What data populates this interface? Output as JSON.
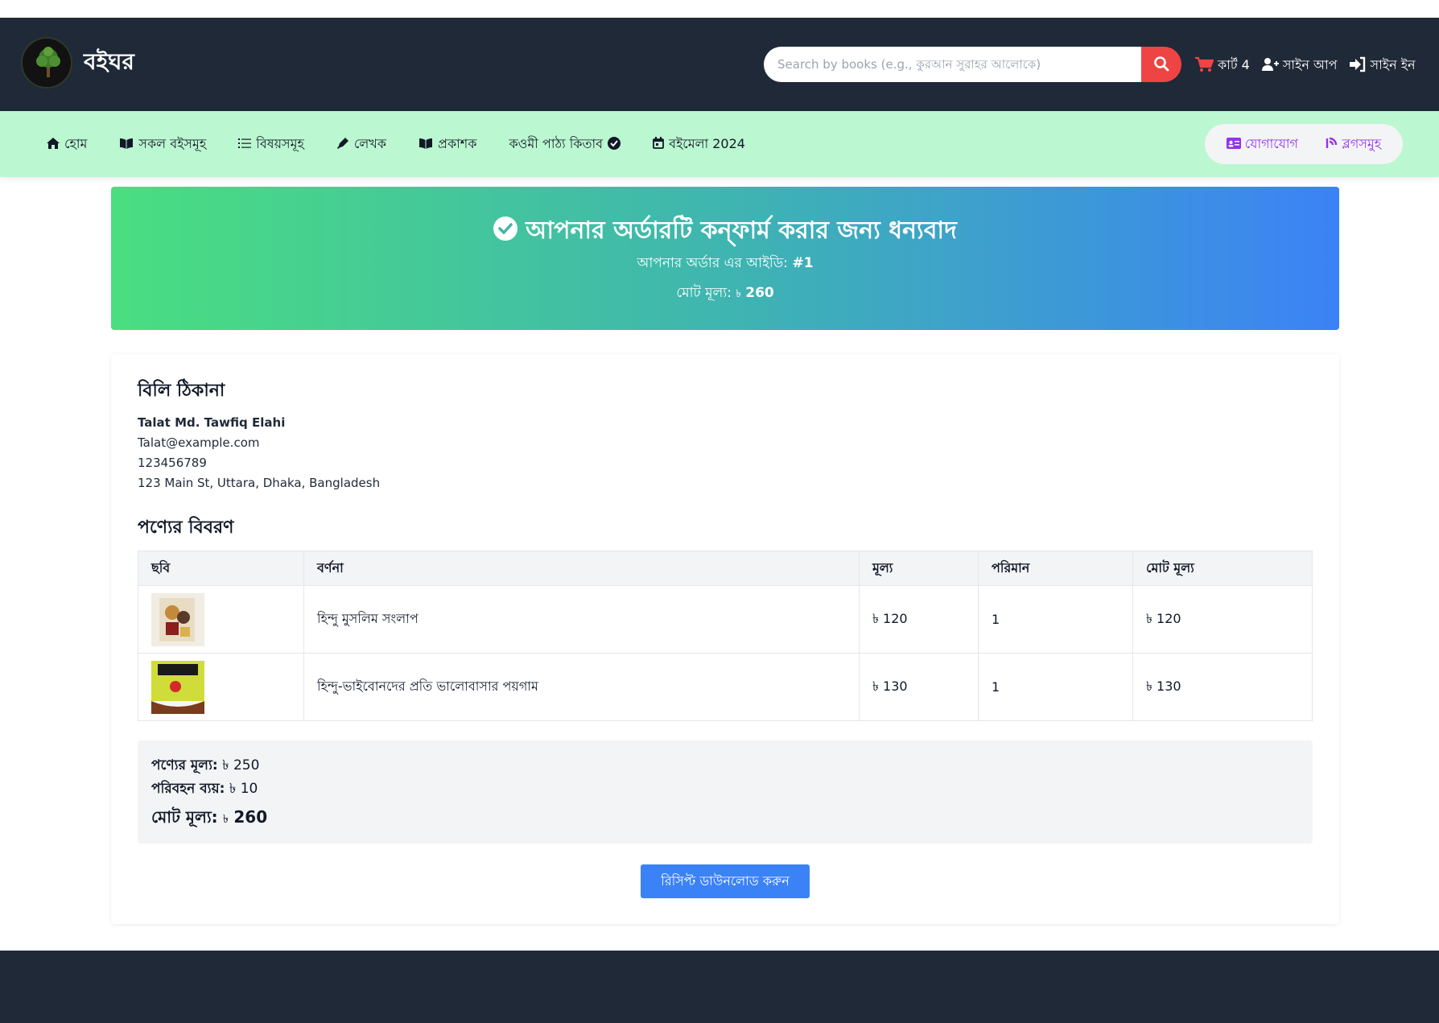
{
  "header": {
    "brand": "বইঘর",
    "search_placeholder": "Search by books (e.g., কুরআন সুরাহর আলোকে)",
    "cart_label": "কার্ট 4",
    "signup_label": "সাইন আপ",
    "signin_label": "সাইন ইন"
  },
  "nav": {
    "items": [
      {
        "label": "হোম",
        "icon": "home-icon"
      },
      {
        "label": "সকল বইসমূহ",
        "icon": "book-open-icon"
      },
      {
        "label": "বিষয়সমূহ",
        "icon": "list-icon"
      },
      {
        "label": "লেখক",
        "icon": "pen-icon"
      },
      {
        "label": "প্রকাশক",
        "icon": "book-open-icon"
      },
      {
        "label": "কওমী পাঠ্য কিতাব",
        "icon": "check-circle-icon"
      },
      {
        "label": "বইমেলা 2024",
        "icon": "calendar-icon"
      }
    ],
    "contact_label": "যোগাযোগ",
    "blogs_label": "ব্লগসমুহ"
  },
  "banner": {
    "title": "আপনার অর্ডারটি কন্ফার্ম করার জন্য ধন্যবাদ",
    "order_id_label": "আপনার অর্ডার এর আইডি:",
    "order_id": "#1",
    "total_label": "মোট মূল্য:",
    "total_currency": "৳",
    "total_value": "260"
  },
  "billing": {
    "heading": "বিলি ঠিকানা",
    "name": "Talat Md. Tawfiq Elahi",
    "email": "Talat@example.com",
    "phone": "123456789",
    "address": "123 Main St, Uttara, Dhaka, Bangladesh"
  },
  "products": {
    "heading": "পণ্যের বিবরণ",
    "columns": [
      "ছবি",
      "বর্ণনা",
      "মূল্য",
      "পরিমান",
      "মোট মূল্য"
    ],
    "rows": [
      {
        "description": "হিন্দু মুসলিম সংলাপ",
        "price": "৳ 120",
        "quantity": "1",
        "total": "৳ 120"
      },
      {
        "description": "হিন্দু-ভাইবোনদের প্রতি ভালোবাসার পয়গাম",
        "price": "৳ 130",
        "quantity": "1",
        "total": "৳ 130"
      }
    ]
  },
  "summary": {
    "subtotal_label": "পণ্যের মূল্য:",
    "subtotal_value": "৳ 250",
    "shipping_label": "পরিবহন ব্যয়:",
    "shipping_value": "৳ 10",
    "total_label": "মোট মূল্য:",
    "total_currency": "৳",
    "total_value": "260"
  },
  "download_button": "রিসিপ্ট ডাউনলোড করুন",
  "colors": {
    "header_bg": "#1f2937",
    "nav_bg": "#bbf7d0",
    "accent_red": "#ef4444",
    "accent_purple": "#9333ea",
    "button_blue": "#3b82f6",
    "banner_start": "#4ade80",
    "banner_end": "#3b82f6"
  }
}
